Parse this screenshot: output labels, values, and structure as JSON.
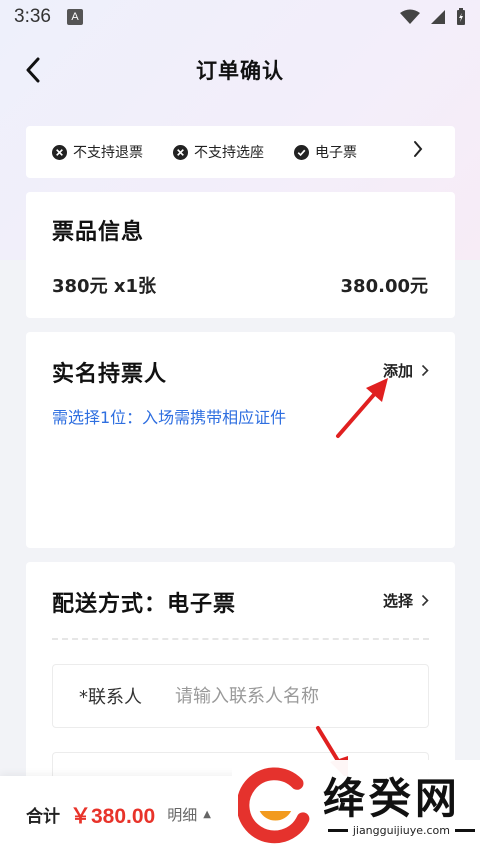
{
  "status_bar": {
    "time": "3:36",
    "notification_glyph": "A"
  },
  "header": {
    "title": "订单确认"
  },
  "tags": {
    "items": [
      {
        "label": "不支持退票",
        "icon": "close-circle-icon"
      },
      {
        "label": "不支持选座",
        "icon": "close-circle-icon"
      },
      {
        "label": "电子票",
        "icon": "check-circle-icon"
      }
    ]
  },
  "ticket_info": {
    "title": "票品信息",
    "quantity_text": "380元 x1张",
    "total_text": "380.00元"
  },
  "ticket_holder": {
    "title": "实名持票人",
    "add_label": "添加",
    "hint": "需选择1位：入场需携带相应证件"
  },
  "delivery": {
    "title": "配送方式：电子票",
    "select_label": "选择",
    "contact_label": "*联系人",
    "contact_placeholder": "请输入联系人名称"
  },
  "bottom_bar": {
    "total_label": "合计",
    "total_amount": "￥380.00",
    "detail_label": "明细"
  },
  "watermark": {
    "brand": "绛癸网",
    "url": "jiangguijiuye.com"
  },
  "colors": {
    "accent_red": "#e8332a",
    "hint_blue": "#2f6fe0",
    "annotation_red": "#e02020",
    "logo_red": "#e5322d",
    "logo_orange": "#f29a1e"
  }
}
